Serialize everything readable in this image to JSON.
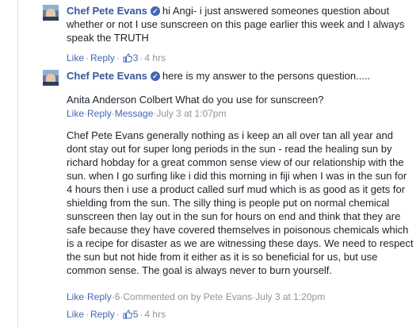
{
  "comments": [
    {
      "author": "Chef Pete Evans",
      "text": "hi Angi- i just answered someones question about whether or not I use sunscreen on this page earlier this week and I always speak the TRUTH",
      "like_label": "Like",
      "reply_label": "Reply",
      "likes": "3",
      "time": "4 hrs"
    },
    {
      "author": "Chef Pete Evans",
      "text": "here is my answer to the persons question.....",
      "like_label": "Like",
      "reply_label": "Reply",
      "likes": "5",
      "time": "4 hrs",
      "quoted": [
        {
          "text": "Anita Anderson Colbert What do you use for sunscreen?",
          "like_label": "Like",
          "reply_label": "Reply",
          "message_label": "Message",
          "time": "July 3 at 1:07pm"
        },
        {
          "text": "Chef Pete Evans generally nothing as i keep an all over tan all year and dont stay out for super long periods in the sun - read the healing sun by richard hobday for a great common sense view of our relationship with the sun. when I go surfing like i did this morning in fiji when I was in the sun for 4 hours then i use a product called surf mud which is as good as it gets for shielding from the sun. The silly thing is people put on normal chemical sunscreen then lay out in the sun for hours on end and think that they are safe because they have covered themselves in poisonous chemicals which is a recipe for disaster as we are witnessing these days. We need to respect the sun but not hide from it either as it is so beneficial for us, but use common sense. The goal is always never to burn yourself.",
          "like_label": "Like",
          "reply_label": "Reply",
          "count": "6",
          "commented_label": "Commented on by Pete Evans",
          "time": "July 3 at 1:20pm"
        }
      ]
    }
  ],
  "colors": {
    "link": "#4267b2",
    "name": "#365899",
    "meta": "#90949c",
    "text": "#1d2129"
  }
}
